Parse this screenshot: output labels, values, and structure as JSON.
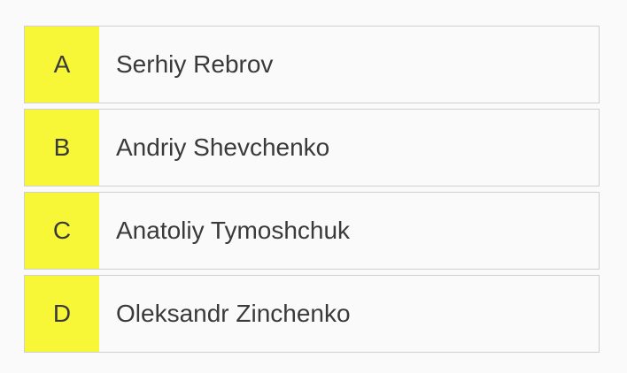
{
  "quiz": {
    "options": [
      {
        "letter": "A",
        "text": "Serhiy Rebrov"
      },
      {
        "letter": "B",
        "text": "Andriy Shevchenko"
      },
      {
        "letter": "C",
        "text": "Anatoliy Tymoshchuk"
      },
      {
        "letter": "D",
        "text": "Oleksandr Zinchenko"
      }
    ],
    "colors": {
      "letter_bg": "#f8f737",
      "card_bg": "#fafafa",
      "border": "#cfcfcf",
      "text": "#3a3a3a"
    }
  }
}
